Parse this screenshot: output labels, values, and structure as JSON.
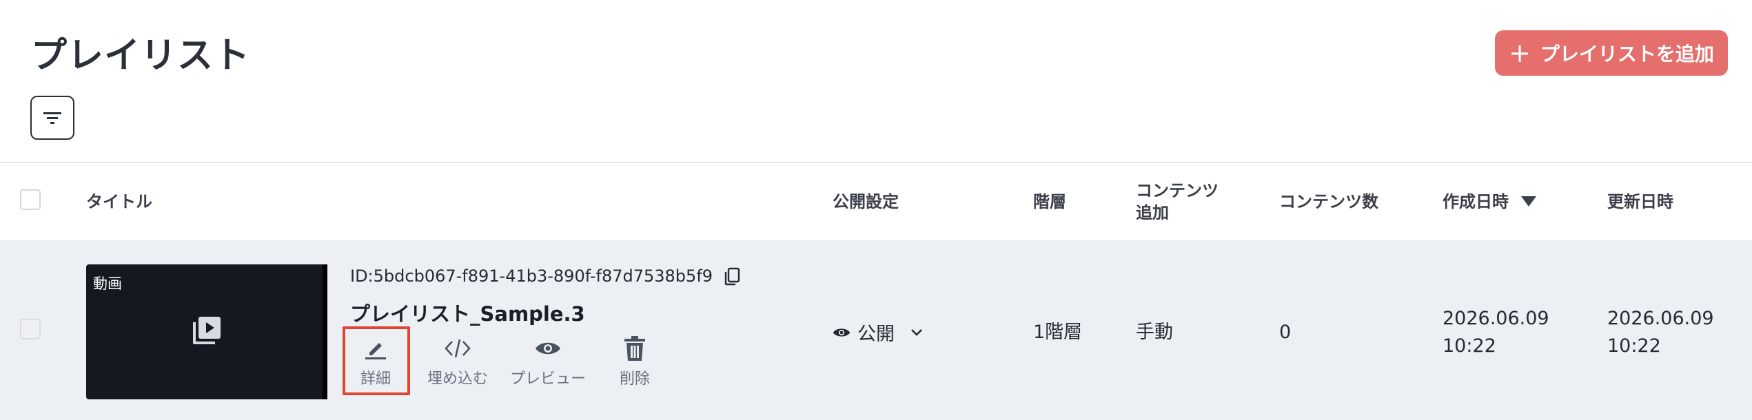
{
  "page": {
    "title": "プレイリスト"
  },
  "toolbar": {
    "add_label": "プレイリストを追加",
    "add_plus": "+"
  },
  "icons": {
    "filter": "filter-icon",
    "select": "checkbox-icon",
    "sort": "sort-desc-icon",
    "video": "play-library-icon",
    "copy": "copy-icon",
    "edit": "pencil-icon",
    "embed": "code-icon",
    "preview": "eye-icon",
    "delete": "trash-icon",
    "dropdown": "chevron-down-icon"
  },
  "colors": {
    "accent": "#e46f6c",
    "row_bg": "#eceff4",
    "highlight": "#e2452f"
  },
  "table": {
    "columns": {
      "title": "タイトル",
      "visibility": "公開設定",
      "hierarchy": "階層",
      "content_add_line1": "コンテンツ",
      "content_add_line2": "追加",
      "content_count": "コンテンツ数",
      "created": "作成日時",
      "updated": "更新日時"
    },
    "rows": [
      {
        "thumb_tag": "動画",
        "id": "ID:5bdcb067-f891-41b3-890f-f87d7538b5f9",
        "name": "プレイリスト_Sample.3",
        "actions": {
          "detail": "詳細",
          "embed": "埋め込む",
          "preview": "プレビュー",
          "delete": "削除"
        },
        "visibility": "公開",
        "hierarchy": "1階層",
        "content_add": "手動",
        "content_count": "0",
        "created_date": "2026.06.09",
        "created_time": "10:22",
        "updated_date": "2026.06.09",
        "updated_time": "10:22"
      }
    ]
  }
}
